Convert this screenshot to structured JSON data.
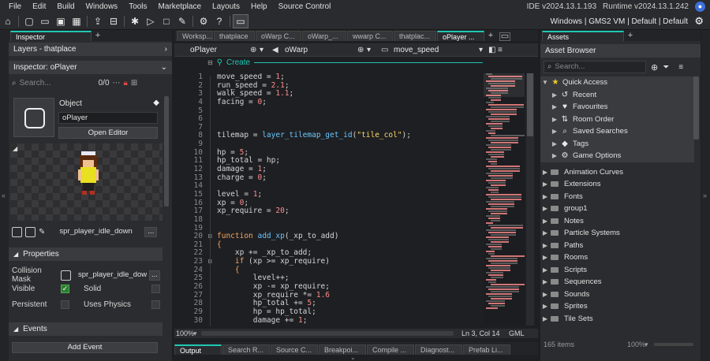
{
  "menu": [
    "File",
    "Edit",
    "Build",
    "Windows",
    "Tools",
    "Marketplace",
    "Layouts",
    "Help",
    "Source Control"
  ],
  "versions": {
    "ide": "IDE v2024.13.1.193",
    "runtime": "Runtime v2024.13.1.242"
  },
  "config_bar": "Windows | GMS2 VM | Default | Default",
  "inspector": {
    "tab_label": "Inspector",
    "layers_header": "Layers - thatplace",
    "object_header": "Inspector: oPlayer",
    "search_placeholder": "Search...",
    "search_count": "0/0",
    "object_label": "Object",
    "object_name": "oPlayer",
    "open_editor": "Open Editor",
    "sprite_name": "spr_player_idle_down",
    "properties_label": "Properties",
    "collision_mask_label": "Collision Mask",
    "collision_mask_value": "spr_player_idle_dow",
    "visible_label": "Visible",
    "solid_label": "Solid",
    "persistent_label": "Persistent",
    "uses_physics_label": "Uses Physics",
    "events_label": "Events",
    "add_event": "Add Event",
    "more": "..."
  },
  "editor": {
    "tabs": [
      "Worksp...",
      "thatplace",
      "oWarp C...",
      "oWarp_...",
      "wwarp C...",
      "thatplac...",
      "oPlayer ..."
    ],
    "object_selector": "oPlayer",
    "warp_selector": "oWarp",
    "sprite_selector": "move_speed",
    "create_label": "Create",
    "zoom": "100%",
    "cursor_pos": "Ln 3, Col 14",
    "language": "GML",
    "lines": [
      {
        "n": "1",
        "t": [
          [
            "var",
            "move_speed = "
          ],
          [
            "num",
            "1"
          ],
          [
            "var",
            ";"
          ]
        ]
      },
      {
        "n": "2",
        "t": [
          [
            "var",
            "run_speed = "
          ],
          [
            "num",
            "2.1"
          ],
          [
            "var",
            ";"
          ]
        ]
      },
      {
        "n": "3",
        "t": [
          [
            "var",
            "walk_speed = "
          ],
          [
            "num",
            "1.1"
          ],
          [
            "var",
            ";"
          ]
        ]
      },
      {
        "n": "4",
        "t": [
          [
            "var",
            "facing = "
          ],
          [
            "num",
            "0"
          ],
          [
            "var",
            ";"
          ]
        ]
      },
      {
        "n": "5",
        "t": []
      },
      {
        "n": "6",
        "t": []
      },
      {
        "n": "7",
        "t": []
      },
      {
        "n": "8",
        "t": [
          [
            "var",
            "tilemap = "
          ],
          [
            "fn",
            "layer_tilemap_get_id"
          ],
          [
            "var",
            "("
          ],
          [
            "str",
            "\"tile_col\""
          ],
          [
            "var",
            ");"
          ]
        ]
      },
      {
        "n": "9",
        "t": []
      },
      {
        "n": "10",
        "t": [
          [
            "var",
            "hp = "
          ],
          [
            "num",
            "5"
          ],
          [
            "var",
            ";"
          ]
        ]
      },
      {
        "n": "11",
        "t": [
          [
            "var",
            "hp_total = hp;"
          ]
        ]
      },
      {
        "n": "12",
        "t": [
          [
            "var",
            "damage = "
          ],
          [
            "num",
            "1"
          ],
          [
            "var",
            ";"
          ]
        ]
      },
      {
        "n": "13",
        "t": [
          [
            "var",
            "charge = "
          ],
          [
            "num",
            "0"
          ],
          [
            "var",
            ";"
          ]
        ]
      },
      {
        "n": "14",
        "t": []
      },
      {
        "n": "15",
        "t": [
          [
            "var",
            "level = "
          ],
          [
            "num",
            "1"
          ],
          [
            "var",
            ";"
          ]
        ]
      },
      {
        "n": "16",
        "t": [
          [
            "var",
            "xp = "
          ],
          [
            "num",
            "0"
          ],
          [
            "var",
            ";"
          ]
        ]
      },
      {
        "n": "17",
        "t": [
          [
            "var",
            "xp_require = "
          ],
          [
            "num",
            "20"
          ],
          [
            "var",
            ";"
          ]
        ]
      },
      {
        "n": "18",
        "t": []
      },
      {
        "n": "19",
        "t": []
      },
      {
        "n": "20",
        "t": [
          [
            "kw",
            "function "
          ],
          [
            "fn",
            "add_xp"
          ],
          [
            "var",
            "(_xp_to_add)"
          ]
        ]
      },
      {
        "n": "21",
        "t": [
          [
            "kw",
            "{"
          ]
        ]
      },
      {
        "n": "22",
        "t": [
          [
            "var",
            "    xp += _xp_to_add;"
          ]
        ]
      },
      {
        "n": "23",
        "t": [
          [
            "kw",
            "    if "
          ],
          [
            "var",
            "(xp >= xp_require)"
          ]
        ]
      },
      {
        "n": "24",
        "t": [
          [
            "kw",
            "    {"
          ]
        ]
      },
      {
        "n": "25",
        "t": [
          [
            "var",
            "        level++;"
          ]
        ]
      },
      {
        "n": "26",
        "t": [
          [
            "var",
            "        xp -= xp_require;"
          ]
        ]
      },
      {
        "n": "27",
        "t": [
          [
            "var",
            "        xp_require *= "
          ],
          [
            "num",
            "1.6"
          ]
        ]
      },
      {
        "n": "28",
        "t": [
          [
            "var",
            "        hp_total += "
          ],
          [
            "num",
            "5"
          ],
          [
            "var",
            ";"
          ]
        ]
      },
      {
        "n": "29",
        "t": [
          [
            "var",
            "        hp = hp_total;"
          ]
        ]
      },
      {
        "n": "30",
        "t": [
          [
            "var",
            "        damage += "
          ],
          [
            "num",
            "1"
          ],
          [
            "var",
            ";"
          ]
        ]
      }
    ]
  },
  "bottom_tabs": [
    "Output",
    "Search R...",
    "Source C...",
    "Breakpoi...",
    "Compile ...",
    "Diagnost...",
    "Prefab Li..."
  ],
  "assets": {
    "tab_label": "Assets",
    "browser_title": "Asset Browser",
    "search_placeholder": "Search...",
    "quick_access": "Quick Access",
    "quick_items": [
      {
        "label": "Recent",
        "icon": "recent-icon"
      },
      {
        "label": "Favourites",
        "icon": "heart-icon"
      },
      {
        "label": "Room Order",
        "icon": "room-order-icon"
      },
      {
        "label": "Saved Searches",
        "icon": "search-icon"
      },
      {
        "label": "Tags",
        "icon": "tag-icon"
      },
      {
        "label": "Game Options",
        "icon": "gear-icon"
      }
    ],
    "folders": [
      "Animation Curves",
      "Extensions",
      "Fonts",
      "group1",
      "Notes",
      "Particle Systems",
      "Paths",
      "Rooms",
      "Scripts",
      "Sequences",
      "Sounds",
      "Sprites",
      "Tile Sets"
    ],
    "item_count": "165 items",
    "zoom": "100%"
  }
}
